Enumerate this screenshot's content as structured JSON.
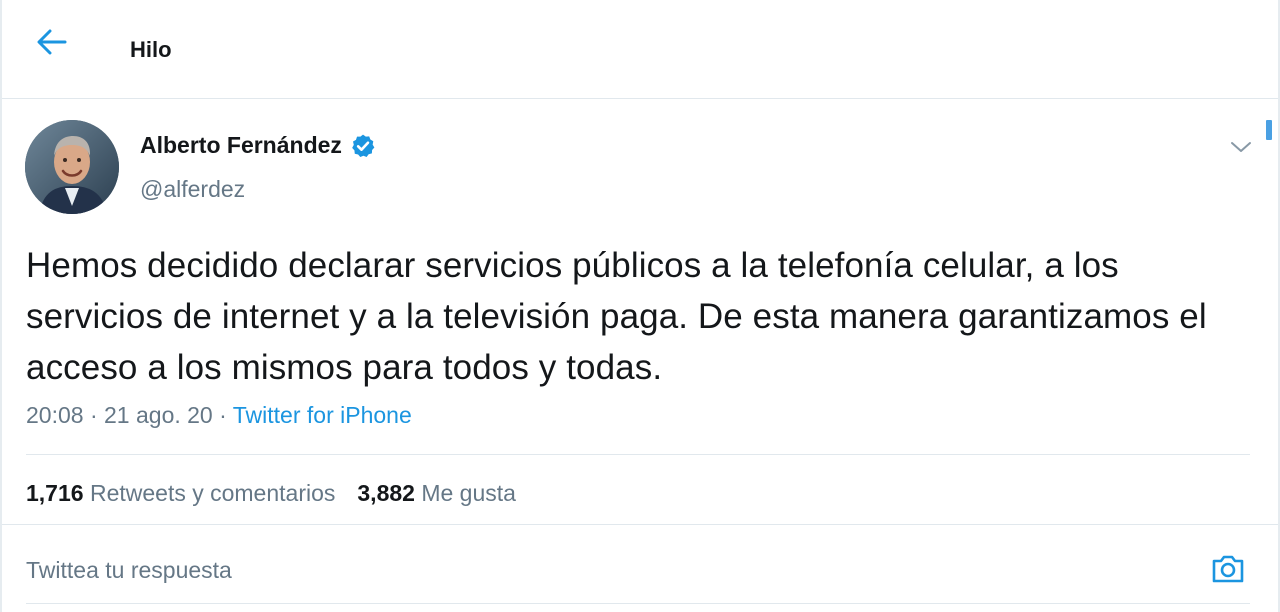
{
  "header": {
    "title": "Hilo",
    "back_icon": "arrow-left-icon"
  },
  "colors": {
    "accent": "#1b95e0",
    "text_primary": "#14171a",
    "text_secondary": "#657786",
    "divider": "#e1e8ed"
  },
  "tweet": {
    "display_name": "Alberto Fernández",
    "verified_icon": "verified-badge-icon",
    "handle": "@alferdez",
    "menu_icon": "chevron-down-icon",
    "text": "Hemos decidido declarar servicios públicos a la telefonía celular, a los servicios de internet y a la televisión paga. De esta manera garantizamos el acceso a los mismos para todos y todas.",
    "time": "20:08",
    "date": "21 ago. 20",
    "separator": "·",
    "source": "Twitter for iPhone"
  },
  "stats": {
    "retweets_count": "1,716",
    "retweets_label": "Retweets y comentarios",
    "likes_count": "3,882",
    "likes_label": "Me gusta"
  },
  "reply": {
    "placeholder": "Twittea tu respuesta",
    "camera_icon": "camera-icon"
  }
}
